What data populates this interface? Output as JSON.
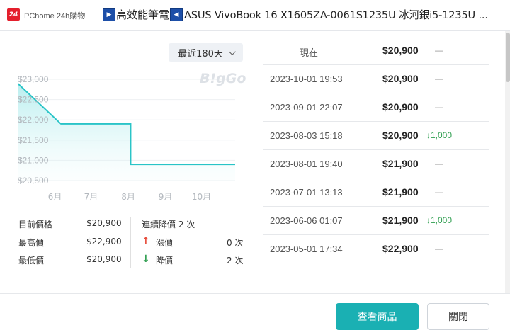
{
  "header": {
    "store_logo": "24",
    "store_name": "PChome 24h購物",
    "category": "高效能筆電",
    "product_title": "ASUS VivoBook 16 X1605ZA-0061S1235U 冰河銀i5-1235U ..."
  },
  "range_select": {
    "label": "最近180天"
  },
  "watermark": "B!gGo",
  "chart_data": {
    "type": "area",
    "x_ticks": [
      "6月",
      "7月",
      "8月",
      "9月",
      "10月"
    ],
    "y_ticks": [
      "$23,000",
      "$22,500",
      "$22,000",
      "$21,500",
      "$21,000",
      "$20,500"
    ],
    "ylim": [
      20500,
      23000
    ],
    "x": [
      "2023-05-01",
      "2023-06-06",
      "2023-08-03",
      "2023-10-29"
    ],
    "values": [
      22900,
      21900,
      21900,
      20900
    ],
    "step_at": "2023-08-03",
    "color": "#2ac4c7"
  },
  "stats": {
    "current_label": "目前價格",
    "current_value": "$20,900",
    "max_label": "最高價",
    "max_value": "$22,900",
    "min_label": "最低價",
    "min_value": "$20,900"
  },
  "trend": {
    "title": "連續降價 2 次",
    "up_label": "漲價",
    "up_count": "0 次",
    "down_label": "降價",
    "down_count": "2 次"
  },
  "history": [
    {
      "date": "現在",
      "price": "$20,900",
      "change": "—"
    },
    {
      "date": "2023-10-01 19:53",
      "price": "$20,900",
      "change": "—"
    },
    {
      "date": "2023-09-01 22:07",
      "price": "$20,900",
      "change": "—"
    },
    {
      "date": "2023-08-03 15:18",
      "price": "$20,900",
      "change": "1,000",
      "direction": "down"
    },
    {
      "date": "2023-08-01 19:40",
      "price": "$21,900",
      "change": "—"
    },
    {
      "date": "2023-07-01 13:13",
      "price": "$21,900",
      "change": "—"
    },
    {
      "date": "2023-06-06 01:07",
      "price": "$21,900",
      "change": "1,000",
      "direction": "down"
    },
    {
      "date": "2023-05-01 17:34",
      "price": "$22,900",
      "change": "—"
    }
  ],
  "buttons": {
    "view_label": "查看商品",
    "close_label": "關閉"
  }
}
